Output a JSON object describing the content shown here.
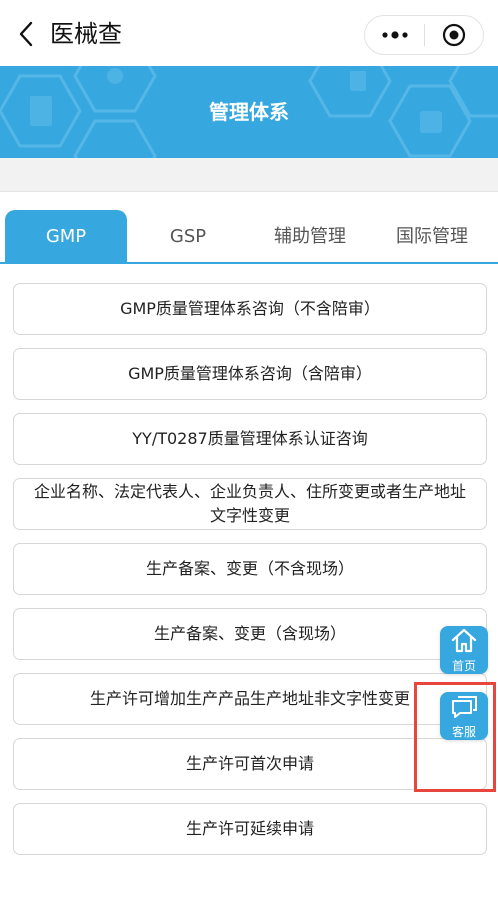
{
  "navbar": {
    "title": "医械查",
    "back_icon": "chevron-left-icon",
    "more_icon": "more-dots-icon",
    "close_icon": "target-circle-icon"
  },
  "banner": {
    "title": "管理体系",
    "color": "#37a7e0"
  },
  "tabs": [
    {
      "label": "GMP",
      "active": true
    },
    {
      "label": "GSP",
      "active": false
    },
    {
      "label": "辅助管理",
      "active": false
    },
    {
      "label": "国际管理",
      "active": false
    }
  ],
  "items": [
    {
      "label": "GMP质量管理体系咨询（不含陪审）"
    },
    {
      "label": "GMP质量管理体系咨询（含陪审）"
    },
    {
      "label": "YY/T0287质量管理体系认证咨询"
    },
    {
      "label": "企业名称、法定代表人、企业负责人、住所变更或者生产地址文字性变更"
    },
    {
      "label": "生产备案、变更（不含现场）"
    },
    {
      "label": "生产备案、变更（含现场）"
    },
    {
      "label": "生产许可增加生产产品生产地址非文字性变更"
    },
    {
      "label": "生产许可首次申请"
    },
    {
      "label": "生产许可延续申请"
    }
  ],
  "floating": {
    "home_label": "首页",
    "home_icon": "home-icon",
    "service_label": "客服",
    "service_icon": "chat-bubble-icon"
  },
  "colors": {
    "accent": "#37a7e0",
    "highlight": "#e8453c"
  }
}
